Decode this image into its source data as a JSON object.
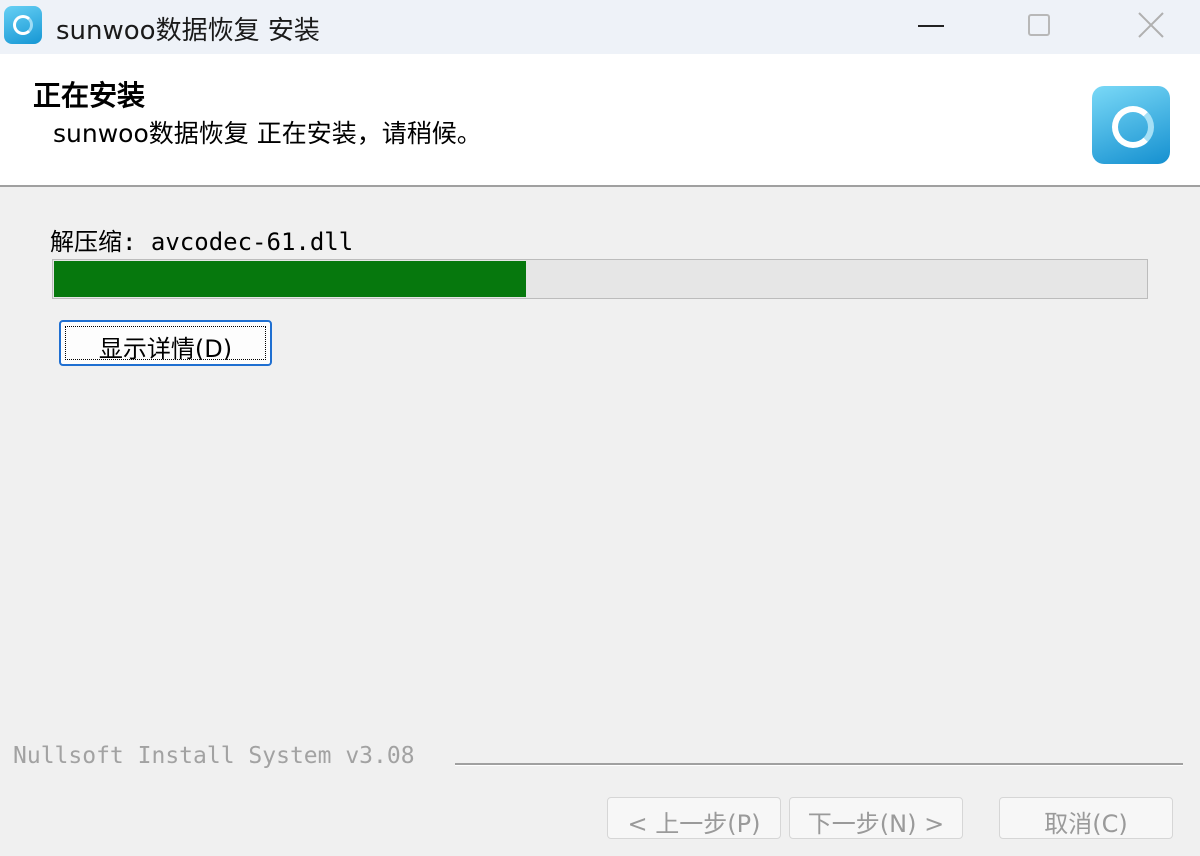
{
  "window": {
    "title": "sunwoo数据恢复 安装",
    "icon": "app-logo-icon",
    "controls": {
      "minimize": "minimize-icon",
      "maximize": "maximize-icon",
      "close": "close-icon"
    }
  },
  "header": {
    "title": "正在安装",
    "subtitle": "sunwoo数据恢复 正在安装，请稍候。",
    "logo": "app-logo-icon"
  },
  "progress": {
    "status": "解压缩: avcodec-61.dll",
    "fraction": 0.433,
    "fill_color": "#06780d",
    "track_color": "#e6e6e6"
  },
  "details_button": {
    "label": "显示详情(D)"
  },
  "footer": {
    "brand": "Nullsoft Install System v3.08",
    "back_label": "< 上一步(P)",
    "next_label": "下一步(N) >",
    "cancel_label": "取消(C)"
  },
  "colors": {
    "focus_border": "#1f6fd1",
    "disabled_text": "#9a9a9a"
  }
}
